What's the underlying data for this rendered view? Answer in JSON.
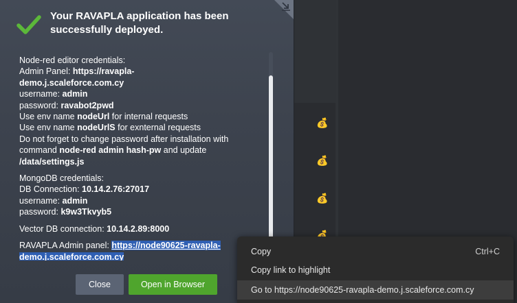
{
  "dialog": {
    "title": "Your RAVAPLA application has been successfully deployed.",
    "lines": {
      "l1": "Node-red editor credentials:",
      "l2a": "Admin Panel: ",
      "l2b": "https://ravapla-",
      "l3": "demo.j.scaleforce.com.cy",
      "l4a": "username: ",
      "l4b": "admin",
      "l5a": "password: ",
      "l5b": "ravabot2pwd",
      "l6a": "Use env name ",
      "l6b": "nodeUrl",
      "l6c": " for internal requests",
      "l7a": "Use env name ",
      "l7b": "nodeUrlS",
      "l7c": " for exnternal requests",
      "l8": "Do not forget to change password after installation with",
      "l9a": "command ",
      "l9b": "node-red admin hash-pw",
      "l9c": " and update",
      "l10": "/data/settings.js",
      "m1": "MongoDB credentials:",
      "m2a": "DB Connection: ",
      "m2b": "10.14.2.76:27017",
      "m3a": "username: ",
      "m3b": "admin",
      "m4a": "password: ",
      "m4b": "k9w3Tkvyb5",
      "v1a": "Vector DB connection: ",
      "v1b": "10.14.2.89:8000",
      "r1a": "RAVAPLA Admin panel: ",
      "r1b": "https://node90625-ravapla-",
      "r2": "demo.j.scaleforce.com.cy"
    },
    "buttons": {
      "close": "Close",
      "open": "Open in Browser"
    }
  },
  "context_menu": {
    "copy": "Copy",
    "copy_shortcut": "Ctrl+C",
    "copy_link": "Copy link to highlight",
    "go_to": "Go to https://node90625-ravapla-demo.j.scaleforce.com.cy"
  },
  "colors": {
    "accent_green": "#4fa52d",
    "check_green": "#5cb83a",
    "selection_blue": "#2f5fb3",
    "icon_gold": "#c9a33a"
  },
  "icons": {
    "check": "checkmark-icon",
    "collapse": "collapse-arrow-icon",
    "money": "money-bag-icon"
  }
}
